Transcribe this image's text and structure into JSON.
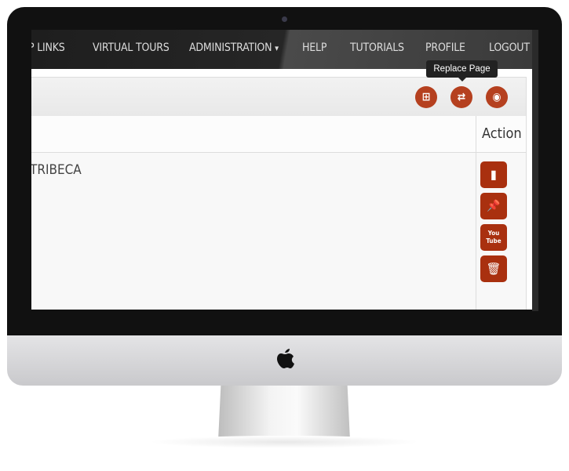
{
  "nav": {
    "items": [
      "P LINKS",
      "VIRTUAL TOURS",
      "ADMINISTRATION",
      "HELP",
      "TUTORIALS",
      "PROFILE",
      "LOGOUT"
    ],
    "dropdown_caret": "▾"
  },
  "tooltip": "Replace Page",
  "toolbar": {
    "buttons": [
      {
        "icon": "plus-square-icon",
        "glyph": "⊞"
      },
      {
        "icon": "exchange-icon",
        "glyph": "⇄"
      },
      {
        "icon": "eye-icon",
        "glyph": "◉"
      }
    ]
  },
  "table": {
    "header_action": "Action",
    "rows": [
      {
        "name": "TRIBECA"
      }
    ]
  },
  "actions": [
    {
      "icon": "file-icon",
      "glyph": "▮"
    },
    {
      "icon": "pushpin-icon",
      "glyph": "📌"
    },
    {
      "icon": "youtube-icon",
      "glyph": "You Tube"
    },
    {
      "icon": "trash-icon",
      "glyph": "🗑"
    }
  ],
  "colors": {
    "accent": "#b5401f",
    "action": "#a9300f",
    "nav": "#262626"
  }
}
